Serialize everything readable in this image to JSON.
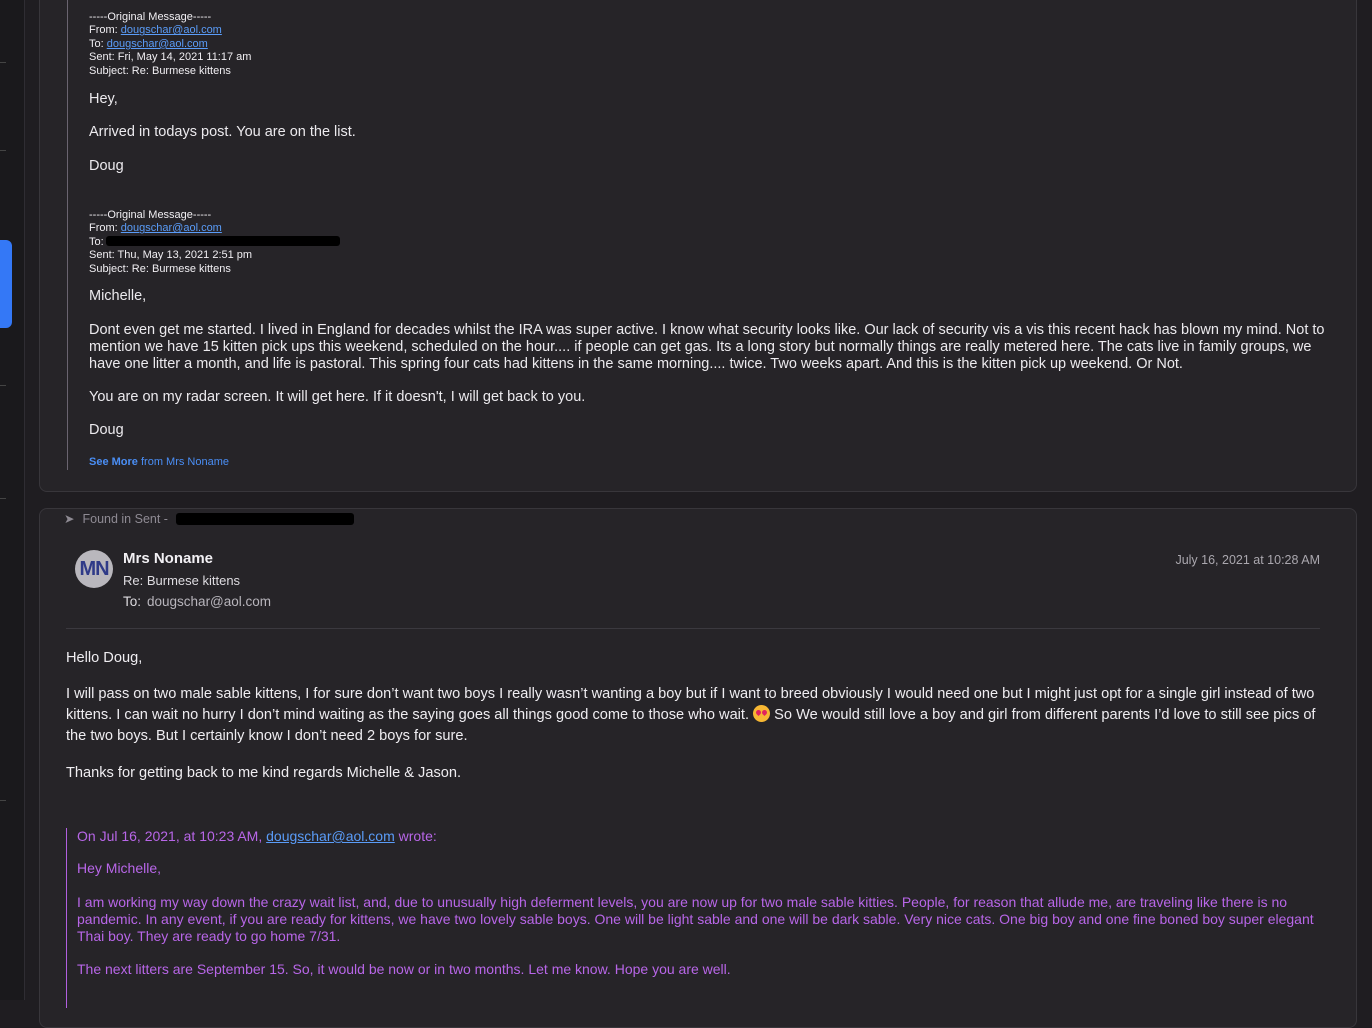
{
  "message1": {
    "header1": {
      "original_line": "-----Original Message-----",
      "from_label": "From:",
      "from": "dougschar@aol.com",
      "to_label": "To:",
      "to": "dougschar@aol.com",
      "sent": "Sent: Fri, May 14, 2021 11:17 am",
      "subject": "Subject: Re: Burmese kittens"
    },
    "greeting": "Hey,",
    "line1": "Arrived in todays post. You are on the list.",
    "signoff": "Doug",
    "header2": {
      "original_line": "-----Original Message-----",
      "from_label": "From:",
      "from": "dougschar@aol.com",
      "to_label": "To:",
      "sent": "Sent: Thu, May 13, 2021 2:51 pm",
      "subject": "Subject: Re: Burmese kittens"
    },
    "greeting2": "Michelle,",
    "paragraph": "Dont even get me started. I lived in England for decades whilst the IRA was super active. I know what security looks like. Our lack of security vis a vis this recent hack has blown my mind. Not to mention we have 15 kitten pick ups this weekend, scheduled on the hour.... if people can get gas. Its a long story but normally things are really metered here. The cats live in family groups, we have one litter a month, and life is pastoral. This spring four cats had kittens in the same morning.... twice. Two weeks apart. And this is the kitten pick up weekend. Or Not.",
    "radar": "You are on my radar screen. It will get here. If it doesn't, I will get back to you.",
    "signoff2": "Doug",
    "see_more": "See More",
    "see_more_from": "from Mrs Noname"
  },
  "message2": {
    "found_in": "Found in Sent -",
    "avatar_initials": "MN",
    "sender": "Mrs Noname",
    "subject": "Re: Burmese kittens",
    "to_label": "To:",
    "to": "dougschar@aol.com",
    "date": "July 16, 2021 at 10:28 AM",
    "greeting": "Hello Doug,",
    "para1": "I will pass on two male sable kittens, I for sure don’t want two boys I really wasn’t wanting a boy but if I want to breed obviously I would need one but I might just opt for a single girl instead of two kittens. I can wait no hurry I don’t mind waiting as the saying goes all things good come to those who wait.",
    "para1b": "So We would still love a boy and girl from different parents I’d love to still see pics of the two boys. But I certainly know I don’t need 2 boys for sure.",
    "para2": "Thanks for getting back to me kind regards Michelle & Jason.",
    "quote_intro_pre": "On Jul 16, 2021, at 10:23 AM,",
    "quote_intro_email": "dougschar@aol.com",
    "quote_intro_post": "wrote:",
    "quote_greeting": "Hey Michelle,",
    "quote_para1": "I am working my way down the crazy wait list, and, due to unusually high deferment levels, you are now up for two male sable kitties. People, for reason that allude me, are traveling like there is no pandemic. In any event, if you are ready for kittens, we have two lovely sable boys. One will be light sable and one will be dark sable. Very nice cats. One big boy and one fine boned boy super elegant Thai boy. They are ready to go home 7/31.",
    "quote_para2": "The next litters are September 15. So, it would be now or in two months. Let me know. Hope you are well."
  }
}
